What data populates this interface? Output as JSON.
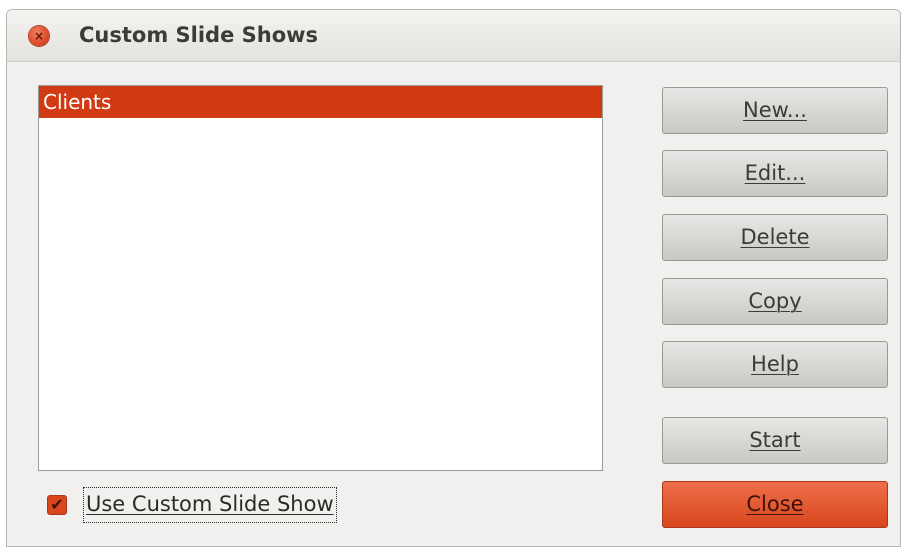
{
  "window": {
    "title": "Custom Slide Shows",
    "close_glyph": "×"
  },
  "list": {
    "items": [
      {
        "label": "Clients",
        "selected": true
      }
    ]
  },
  "buttons": {
    "new": "New...",
    "edit": "Edit...",
    "delete": "Delete",
    "copy": "Copy",
    "help": "Help",
    "start": "Start",
    "close": "Close"
  },
  "checkbox": {
    "label": "Use Custom Slide Show",
    "checked": true,
    "check_glyph": "✔"
  },
  "colors": {
    "accent": "#d13b13",
    "primary_button": "#d9461e"
  },
  "icons": {
    "window_close": "close-icon",
    "checkbox": "checkmark-icon"
  }
}
